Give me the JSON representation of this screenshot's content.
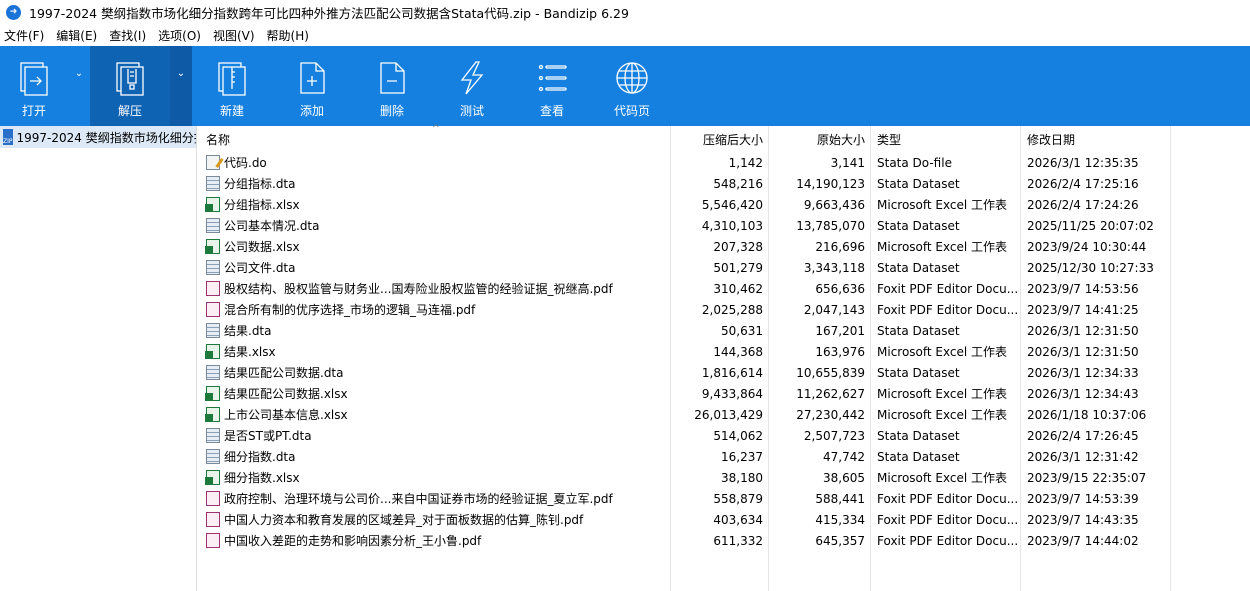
{
  "window": {
    "title": "1997-2024 樊纲指数市场化细分指数跨年可比四种外推方法匹配公司数据含Stata代码.zip - Bandizip 6.29"
  },
  "menu": [
    "文件(F)",
    "编辑(E)",
    "查找(I)",
    "选项(O)",
    "视图(V)",
    "帮助(H)"
  ],
  "toolbar": {
    "open": "打开",
    "extract": "解压",
    "new": "新建",
    "add": "添加",
    "delete": "删除",
    "test": "测试",
    "view": "查看",
    "codepage": "代码页"
  },
  "tree": {
    "root": "1997-2024 樊纲指数市场化细分指数跨年可比四种外推方法匹配公司数据含Stata代码.zip"
  },
  "columns": {
    "name": "名称",
    "compressed": "压缩后大小",
    "original": "原始大小",
    "type": "类型",
    "modified": "修改日期"
  },
  "files": [
    {
      "name": "代码.do",
      "kind": "do",
      "compressed": "1,142",
      "original": "3,141",
      "type": "Stata Do-file",
      "modified": "2026/3/1 12:35:35"
    },
    {
      "name": "分组指标.dta",
      "kind": "dta",
      "compressed": "548,216",
      "original": "14,190,123",
      "type": "Stata Dataset",
      "modified": "2026/2/4 17:25:16"
    },
    {
      "name": "分组指标.xlsx",
      "kind": "xlsx",
      "compressed": "5,546,420",
      "original": "9,663,436",
      "type": "Microsoft Excel 工作表",
      "modified": "2026/2/4 17:24:26"
    },
    {
      "name": "公司基本情况.dta",
      "kind": "dta",
      "compressed": "4,310,103",
      "original": "13,785,070",
      "type": "Stata Dataset",
      "modified": "2025/11/25 20:07:02"
    },
    {
      "name": "公司数据.xlsx",
      "kind": "xlsx",
      "compressed": "207,328",
      "original": "216,696",
      "type": "Microsoft Excel 工作表",
      "modified": "2023/9/24 10:30:44"
    },
    {
      "name": "公司文件.dta",
      "kind": "dta",
      "compressed": "501,279",
      "original": "3,343,118",
      "type": "Stata Dataset",
      "modified": "2025/12/30 10:27:33"
    },
    {
      "name": "股权结构、股权监管与财务业...国寿险业股权监管的经验证据_祝继高.pdf",
      "kind": "pdf",
      "compressed": "310,462",
      "original": "656,636",
      "type": "Foxit PDF Editor Docu...",
      "modified": "2023/9/7 14:53:56"
    },
    {
      "name": "混合所有制的优序选择_市场的逻辑_马连福.pdf",
      "kind": "pdf",
      "compressed": "2,025,288",
      "original": "2,047,143",
      "type": "Foxit PDF Editor Docu...",
      "modified": "2023/9/7 14:41:25"
    },
    {
      "name": "结果.dta",
      "kind": "dta",
      "compressed": "50,631",
      "original": "167,201",
      "type": "Stata Dataset",
      "modified": "2026/3/1 12:31:50"
    },
    {
      "name": "结果.xlsx",
      "kind": "xlsx",
      "compressed": "144,368",
      "original": "163,976",
      "type": "Microsoft Excel 工作表",
      "modified": "2026/3/1 12:31:50"
    },
    {
      "name": "结果匹配公司数据.dta",
      "kind": "dta",
      "compressed": "1,816,614",
      "original": "10,655,839",
      "type": "Stata Dataset",
      "modified": "2026/3/1 12:34:33"
    },
    {
      "name": "结果匹配公司数据.xlsx",
      "kind": "xlsx",
      "compressed": "9,433,864",
      "original": "11,262,627",
      "type": "Microsoft Excel 工作表",
      "modified": "2026/3/1 12:34:43"
    },
    {
      "name": "上市公司基本信息.xlsx",
      "kind": "xlsx",
      "compressed": "26,013,429",
      "original": "27,230,442",
      "type": "Microsoft Excel 工作表",
      "modified": "2026/1/18 10:37:06"
    },
    {
      "name": "是否ST或PT.dta",
      "kind": "dta",
      "compressed": "514,062",
      "original": "2,507,723",
      "type": "Stata Dataset",
      "modified": "2026/2/4 17:26:45"
    },
    {
      "name": "细分指数.dta",
      "kind": "dta",
      "compressed": "16,237",
      "original": "47,742",
      "type": "Stata Dataset",
      "modified": "2026/3/1 12:31:42"
    },
    {
      "name": "细分指数.xlsx",
      "kind": "xlsx",
      "compressed": "38,180",
      "original": "38,605",
      "type": "Microsoft Excel 工作表",
      "modified": "2023/9/15 22:35:07"
    },
    {
      "name": "政府控制、治理环境与公司价...来自中国证券市场的经验证据_夏立军.pdf",
      "kind": "pdf",
      "compressed": "558,879",
      "original": "588,441",
      "type": "Foxit PDF Editor Docu...",
      "modified": "2023/9/7 14:53:39"
    },
    {
      "name": "中国人力资本和教育发展的区域差异_对于面板数据的估算_陈钊.pdf",
      "kind": "pdf",
      "compressed": "403,634",
      "original": "415,334",
      "type": "Foxit PDF Editor Docu...",
      "modified": "2023/9/7 14:43:35"
    },
    {
      "name": "中国收入差距的走势和影响因素分析_王小鲁.pdf",
      "kind": "pdf",
      "compressed": "611,332",
      "original": "645,357",
      "type": "Foxit PDF Editor Docu...",
      "modified": "2023/9/7 14:44:02"
    }
  ]
}
